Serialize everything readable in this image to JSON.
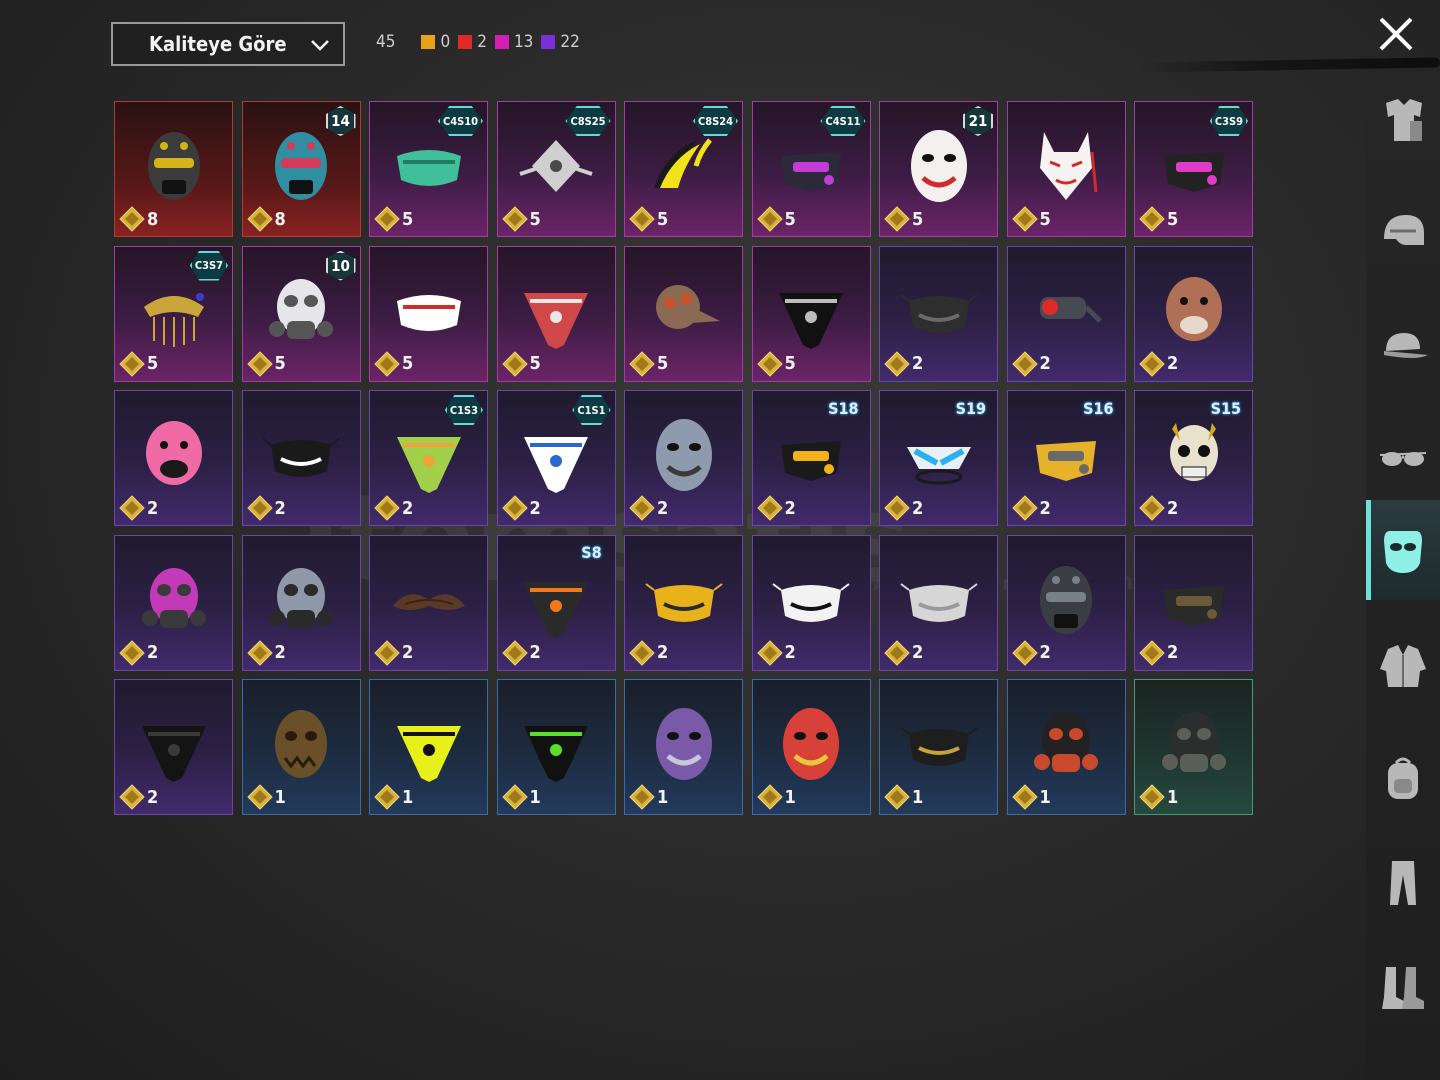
{
  "sort": {
    "label": "Kaliteye Göre"
  },
  "counts": {
    "total": "45",
    "qualities": [
      {
        "color": "#e8a21a",
        "value": "0"
      },
      {
        "color": "#e02828",
        "value": "2"
      },
      {
        "color": "#d21fb4",
        "value": "13"
      },
      {
        "color": "#7a2fd8",
        "value": "22"
      }
    ]
  },
  "watermark": {
    "brand": "itemsatis",
    "sub": "HESAP / ... ITEM / E-...",
    "domain": ".com"
  },
  "sidebar": {
    "items": [
      {
        "icon": "outfit-icon",
        "active": false
      },
      {
        "icon": "helmet-icon",
        "active": false
      },
      {
        "icon": "cap-icon",
        "active": false
      },
      {
        "icon": "glasses-icon",
        "active": false
      },
      {
        "icon": "mask-icon",
        "active": true
      },
      {
        "icon": "jacket-icon",
        "active": false
      },
      {
        "icon": "backpack-icon",
        "active": false
      },
      {
        "icon": "pants-icon",
        "active": false
      },
      {
        "icon": "boots-icon",
        "active": false
      }
    ]
  },
  "items": [
    {
      "rarity": "red",
      "value": "8",
      "badge": "",
      "art": "helmet-mask",
      "color": "#3b3b3b",
      "accent": "#d7b31a"
    },
    {
      "rarity": "red",
      "value": "8",
      "badge": "14",
      "badgeType": "num",
      "art": "helmet-mask",
      "color": "#2f8ea0",
      "accent": "#d23b5a"
    },
    {
      "rarity": "pink",
      "value": "5",
      "badge": "C4S10",
      "badgeType": "code",
      "art": "band-mask",
      "color": "#3fbf9a",
      "accent": "#227a62"
    },
    {
      "rarity": "pink",
      "value": "5",
      "badge": "C8S25",
      "badgeType": "code",
      "art": "spike-mask",
      "color": "#cfcfcf",
      "accent": "#4a4a4a"
    },
    {
      "rarity": "pink",
      "value": "5",
      "badge": "C8S24",
      "badgeType": "code",
      "art": "blade-mask",
      "color": "#f2e21a",
      "accent": "#1a1a1a"
    },
    {
      "rarity": "pink",
      "value": "5",
      "badge": "C4S11",
      "badgeType": "code",
      "art": "tech-mask",
      "color": "#2a2a3a",
      "accent": "#c43bd8"
    },
    {
      "rarity": "pink",
      "value": "5",
      "badge": "21",
      "badgeType": "num",
      "art": "face-mask",
      "color": "#f4f0ef",
      "accent": "#d02a2a"
    },
    {
      "rarity": "pink",
      "value": "5",
      "badge": "",
      "art": "kitsune-mask",
      "color": "#f7f3f2",
      "accent": "#d22a2a"
    },
    {
      "rarity": "pink",
      "value": "5",
      "badge": "C3S9",
      "badgeType": "code",
      "art": "tech-mask",
      "color": "#222222",
      "accent": "#e03ac8"
    },
    {
      "rarity": "pink",
      "value": "5",
      "badge": "C3S7",
      "badgeType": "code",
      "art": "chain-mask",
      "color": "#c9a53a",
      "accent": "#3b3bd0"
    },
    {
      "rarity": "pink",
      "value": "5",
      "badge": "10",
      "badgeType": "num",
      "art": "gas-mask",
      "color": "#e6e6ea",
      "accent": "#555"
    },
    {
      "rarity": "pink",
      "value": "5",
      "badge": "",
      "art": "band-mask",
      "color": "#ffffff",
      "accent": "#d22a2a"
    },
    {
      "rarity": "pink",
      "value": "5",
      "badge": "",
      "art": "bandana",
      "color": "#d04848",
      "accent": "#e8e8e8"
    },
    {
      "rarity": "pink",
      "value": "5",
      "badge": "",
      "art": "plague-mask",
      "color": "#8a6a52",
      "accent": "#c3542f"
    },
    {
      "rarity": "pink",
      "value": "5",
      "badge": "",
      "art": "bandana",
      "color": "#111111",
      "accent": "#bcbcbc"
    },
    {
      "rarity": "purple",
      "value": "2",
      "badge": "",
      "art": "cloth-mask",
      "color": "#2e2e2e",
      "accent": "#6a6a6a"
    },
    {
      "rarity": "purple",
      "value": "2",
      "badge": "",
      "art": "eye-mask",
      "color": "#474a52",
      "accent": "#e02a2a"
    },
    {
      "rarity": "purple",
      "value": "2",
      "badge": "",
      "art": "animal-mask",
      "color": "#b07058",
      "accent": "#e8d8cc"
    },
    {
      "rarity": "purple",
      "value": "2",
      "badge": "",
      "art": "animal-mask",
      "color": "#f06aa6",
      "accent": "#1a1a1a"
    },
    {
      "rarity": "purple",
      "value": "2",
      "badge": "",
      "art": "cloth-mask",
      "color": "#1a1a1a",
      "accent": "#ffffff"
    },
    {
      "rarity": "purple",
      "value": "2",
      "badge": "C1S3",
      "badgeType": "code",
      "art": "bandana",
      "color": "#a2d04a",
      "accent": "#f0a23a"
    },
    {
      "rarity": "purple",
      "value": "2",
      "badge": "C1S1",
      "badgeType": "code",
      "art": "bandana",
      "color": "#ffffff",
      "accent": "#2a68d0"
    },
    {
      "rarity": "purple",
      "value": "2",
      "badge": "",
      "art": "face-mask",
      "color": "#8e9aae",
      "accent": "#3a3a3a"
    },
    {
      "rarity": "purple",
      "value": "2",
      "badge": "S18",
      "badgeType": "season",
      "art": "tech-mask",
      "color": "#1a1a1a",
      "accent": "#f2b21a"
    },
    {
      "rarity": "purple",
      "value": "2",
      "badge": "S19",
      "badgeType": "season",
      "art": "visor-mask",
      "color": "#e8f0f6",
      "accent": "#2ab2f0"
    },
    {
      "rarity": "purple",
      "value": "2",
      "badge": "S16",
      "badgeType": "season",
      "art": "tech-mask",
      "color": "#e6b22a",
      "accent": "#6a6a6a"
    },
    {
      "rarity": "purple",
      "value": "2",
      "badge": "S15",
      "badgeType": "season",
      "art": "skull-mask",
      "color": "#e8e2cc",
      "accent": "#d8a81a"
    },
    {
      "rarity": "purple",
      "value": "2",
      "badge": "",
      "art": "gas-mask",
      "color": "#c23ab8",
      "accent": "#3a3a3a"
    },
    {
      "rarity": "purple",
      "value": "2",
      "badge": "",
      "art": "gas-mask",
      "color": "#8e98a8",
      "accent": "#2a2a2a"
    },
    {
      "rarity": "purple",
      "value": "2",
      "badge": "",
      "art": "mustache",
      "color": "#5a3a26",
      "accent": "#3a2414"
    },
    {
      "rarity": "purple",
      "value": "2",
      "badge": "S8",
      "badgeType": "season",
      "art": "bandana",
      "color": "#2a2a2a",
      "accent": "#f27a1a"
    },
    {
      "rarity": "purple",
      "value": "2",
      "badge": "",
      "art": "cloth-mask",
      "color": "#e8b21a",
      "accent": "#2a2a2a"
    },
    {
      "rarity": "purple",
      "value": "2",
      "badge": "",
      "art": "cloth-mask",
      "color": "#f2f2f2",
      "accent": "#111111"
    },
    {
      "rarity": "purple",
      "value": "2",
      "badge": "",
      "art": "cloth-mask",
      "color": "#d6d6d6",
      "accent": "#9a9a9a"
    },
    {
      "rarity": "purple",
      "value": "2",
      "badge": "",
      "art": "helmet-mask",
      "color": "#3a3e44",
      "accent": "#7a8088"
    },
    {
      "rarity": "purple",
      "value": "2",
      "badge": "",
      "art": "tech-mask",
      "color": "#2a2a2a",
      "accent": "#6a5a3a"
    },
    {
      "rarity": "purple",
      "value": "2",
      "badge": "",
      "art": "bandana",
      "color": "#141414",
      "accent": "#3a3a3a"
    },
    {
      "rarity": "blue",
      "value": "1",
      "badge": "",
      "art": "hockey-mask",
      "color": "#6a5028",
      "accent": "#2a1a0a"
    },
    {
      "rarity": "blue",
      "value": "1",
      "badge": "",
      "art": "bandana",
      "color": "#e8f01a",
      "accent": "#111111"
    },
    {
      "rarity": "blue",
      "value": "1",
      "badge": "",
      "art": "bandana",
      "color": "#111111",
      "accent": "#5ae02a"
    },
    {
      "rarity": "blue",
      "value": "1",
      "badge": "",
      "art": "face-mask",
      "color": "#7a5aa8",
      "accent": "#c8c8d8"
    },
    {
      "rarity": "blue",
      "value": "1",
      "badge": "",
      "art": "face-mask",
      "color": "#d8403a",
      "accent": "#e8c83a"
    },
    {
      "rarity": "blue",
      "value": "1",
      "badge": "",
      "art": "cloth-mask",
      "color": "#1e1e1e",
      "accent": "#c8a23a"
    },
    {
      "rarity": "blue",
      "value": "1",
      "badge": "",
      "art": "gas-mask",
      "color": "#222222",
      "accent": "#c84a2a"
    },
    {
      "rarity": "green",
      "value": "1",
      "badge": "",
      "art": "gas-mask",
      "color": "#2a2e2c",
      "accent": "#5a6058"
    }
  ]
}
